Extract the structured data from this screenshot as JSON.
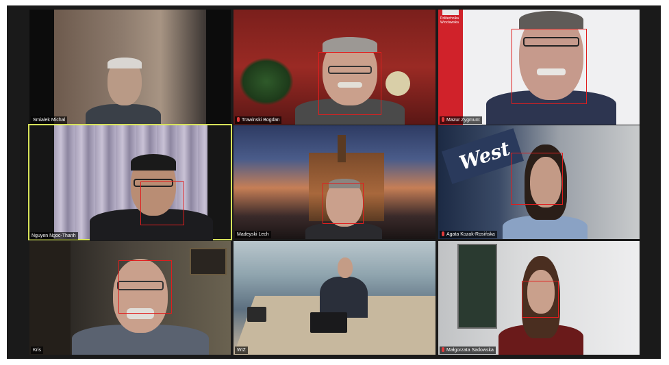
{
  "participants": [
    {
      "name": "Smialek Michal",
      "muted": false
    },
    {
      "name": "Trawinski Bogdan",
      "muted": true
    },
    {
      "name": "Mazur Zygmunt",
      "muted": true
    },
    {
      "name": "Nguyen Ngoc-Thanh",
      "muted": false,
      "active_speaker": true
    },
    {
      "name": "Madeyski Lech",
      "muted": false
    },
    {
      "name": "Agata Kozak-Rosińska",
      "muted": true
    },
    {
      "name": "Kris",
      "muted": false
    },
    {
      "name": "WIZ",
      "muted": false
    },
    {
      "name": "Małgorzata Sadowska",
      "muted": true
    }
  ],
  "backgrounds": {
    "mazur_logo_text": "Politechnika Wrocławska",
    "agata_sign_text": "West"
  },
  "colors": {
    "face_box": "#e01e1e",
    "active_border": "#d8e35a",
    "muted_icon": "#e23b3b"
  }
}
